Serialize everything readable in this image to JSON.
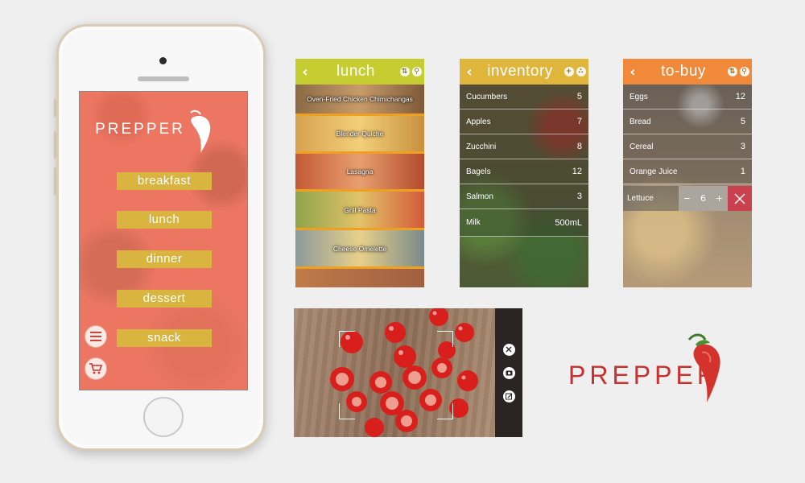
{
  "brand": {
    "name": "PREPPER",
    "red": "#c8312e"
  },
  "home": {
    "menu_items": [
      "breakfast",
      "lunch",
      "dinner",
      "dessert",
      "snack"
    ],
    "icons": [
      "menu-icon",
      "cart-icon"
    ],
    "accent": "#d9b43e"
  },
  "lunch": {
    "title": "lunch",
    "header_color": "#c6cd30",
    "recipes": [
      "Oven-Fried Chicken Chimichangas",
      "Blender Quiche",
      "Lasagna",
      "Grill Pasta",
      "Cheese Omelette"
    ]
  },
  "inventory": {
    "title": "inventory",
    "header_color": "#e0b53c",
    "items": [
      {
        "name": "Cucumbers",
        "qty": "5"
      },
      {
        "name": "Apples",
        "qty": "7"
      },
      {
        "name": "Zucchini",
        "qty": "8"
      },
      {
        "name": "Bagels",
        "qty": "12"
      },
      {
        "name": "Salmon",
        "qty": "3"
      },
      {
        "name": "Milk",
        "qty": "500mL"
      }
    ]
  },
  "tobuy": {
    "title": "to-buy",
    "header_color": "#f08a3a",
    "items": [
      {
        "name": "Eggs",
        "qty": "12"
      },
      {
        "name": "Bread",
        "qty": "5"
      },
      {
        "name": "Cereal",
        "qty": "3"
      },
      {
        "name": "Orange Juice",
        "qty": "1"
      }
    ],
    "editing": {
      "name": "Lettuce",
      "qty": "6",
      "minus": "−",
      "plus": "+"
    }
  }
}
